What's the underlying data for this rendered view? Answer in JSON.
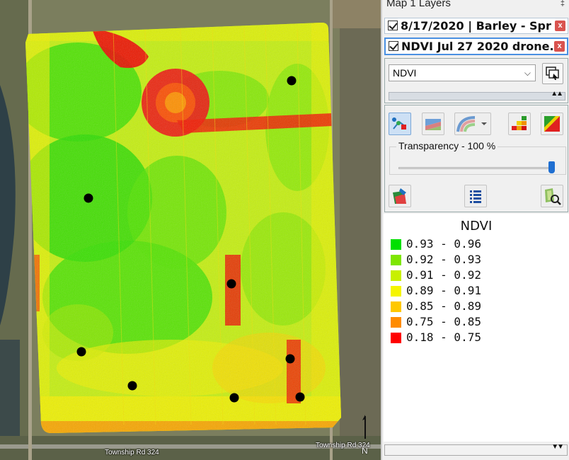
{
  "panel": {
    "title": "Map 1 Layers",
    "layers": [
      {
        "label": "8/17/2020 | Barley - Spr",
        "checked": true
      },
      {
        "label": "NDVI Jul 27 2020 drone.",
        "checked": true
      }
    ],
    "close_label": "x",
    "attribute_dropdown": {
      "selected": "NDVI"
    },
    "tools": [
      "points-icon",
      "layer-style-icon",
      "contour-icon",
      "grid-classes-icon",
      "color-ramp-icon"
    ],
    "transparency_label": "Transparency - 100 %",
    "transparency_value": 1.0,
    "bottom_tools": [
      "paint-layer-icon",
      "list-icon",
      "zoom-layer-icon"
    ]
  },
  "legend": {
    "title": "NDVI",
    "items": [
      {
        "label": "0.93 - 0.96",
        "color": "#00e000"
      },
      {
        "label": "0.92 - 0.93",
        "color": "#7ee600"
      },
      {
        "label": "0.91 - 0.92",
        "color": "#c8f000"
      },
      {
        "label": "0.89 - 0.91",
        "color": "#f5f500"
      },
      {
        "label": "0.85 - 0.89",
        "color": "#ffc800"
      },
      {
        "label": "0.75 - 0.85",
        "color": "#ff8c00"
      },
      {
        "label": "0.18 - 0.75",
        "color": "#ff0000"
      }
    ]
  },
  "map": {
    "road_labels": [
      "Township Rd 324",
      "Township Rd 324"
    ],
    "north_label": "N"
  }
}
